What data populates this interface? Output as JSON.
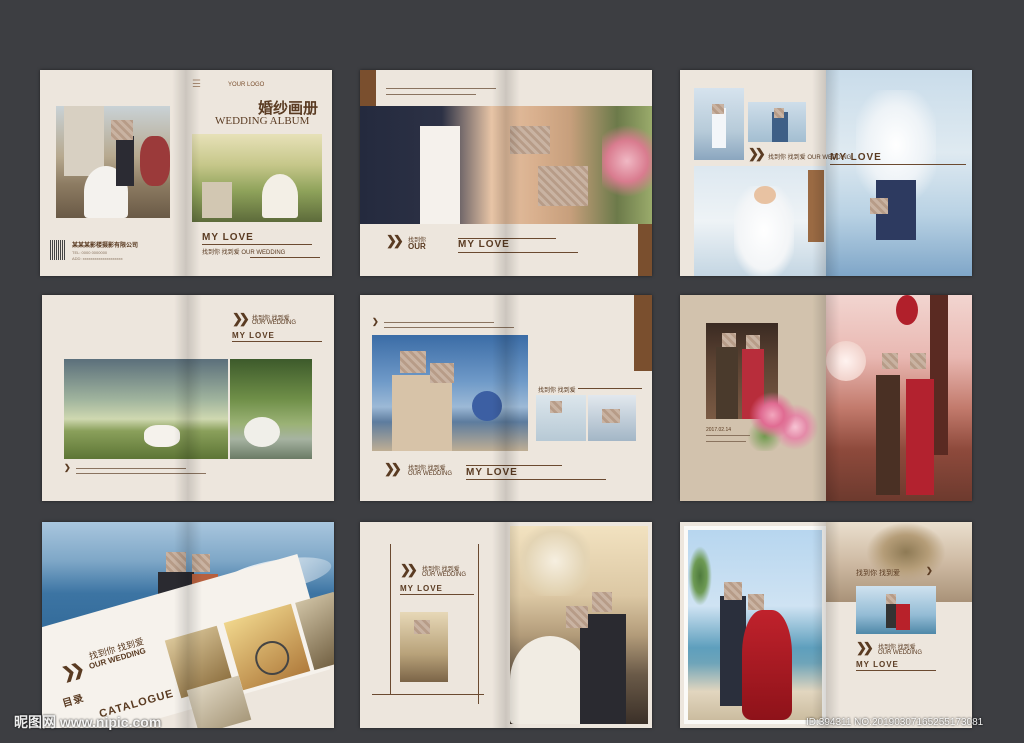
{
  "spread1": {
    "logo": "YOUR LOGO",
    "title_cn": "婚纱画册",
    "title_en": "WEDDING ALBUM",
    "company": "某某某影楼摄影有限公司",
    "contact_lines": [
      "TEL: 0000 0000000",
      "ADD: xxxxxxxxxxxxxxxxxxxx"
    ],
    "my_love": "MY LOVE",
    "subline": "找到你 找到爱 OUR WEDDING"
  },
  "spread2": {
    "tag_cn": "找到你",
    "tag_our": "OUR",
    "my_love": "MY LOVE"
  },
  "spread3": {
    "tag": "找到你 找到爱 OUR WEDDING",
    "my_love": "MY LOVE"
  },
  "spread4": {
    "tag_cn": "找到你 找到爱",
    "tag_en": "OUR WEDDING",
    "my_love": "MY LOVE"
  },
  "spread5": {
    "tag_cn": "找到你 找到爱",
    "tag_en": "OUR WEDDING",
    "my_love": "MY LOVE",
    "right_tag": "找到你 找到爱"
  },
  "spread6": {
    "date": "2017.02.14"
  },
  "spread7": {
    "tag_cn": "找到你 找到爱",
    "tag_en": "OUR WEDDING",
    "catalog_cn": "目录",
    "catalog_en": "CATALOGUE"
  },
  "spread8": {
    "tag_cn": "找到你 找到爱",
    "tag_en": "OUR WEDDING",
    "my_love": "MY LOVE"
  },
  "spread9": {
    "tag_cn": "找到你 找到爱",
    "tag_en": "OUR WEDDING",
    "my_love": "MY LOVE"
  },
  "watermark": {
    "site": "昵图网 www.nipic.com",
    "id_line": "ID:394311 NO:20190307165255173081"
  },
  "colors": {
    "background": "#3d3e42",
    "page": "#ede6dd",
    "accent": "#7a4f2e",
    "text": "#5a3b22"
  }
}
